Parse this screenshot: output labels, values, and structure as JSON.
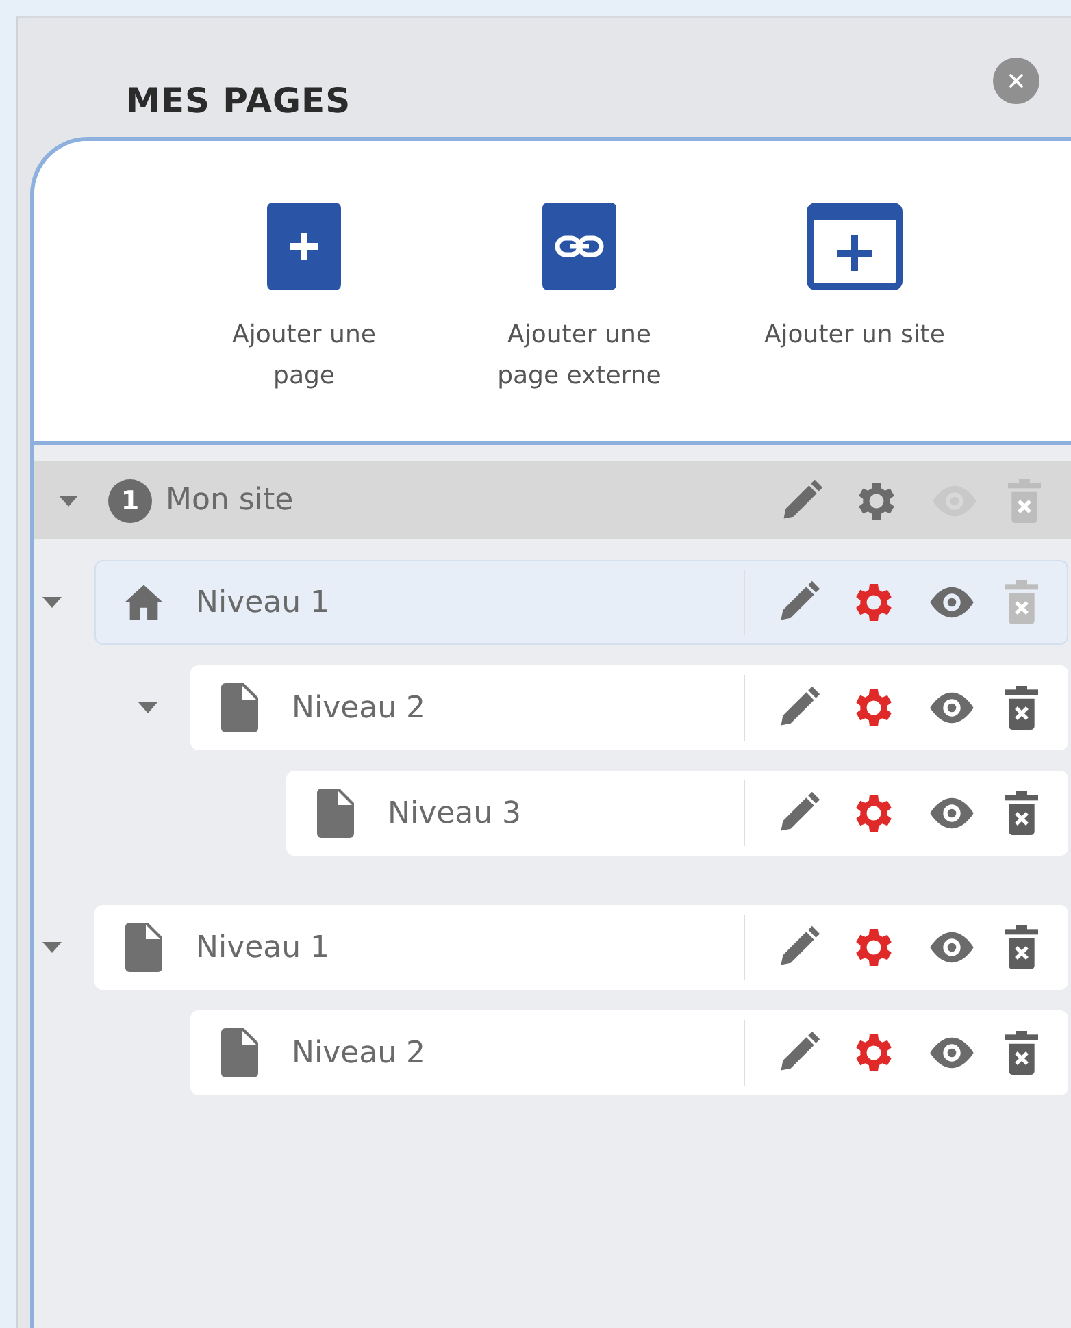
{
  "panel": {
    "title": "MES PAGES"
  },
  "actions": [
    {
      "kind": "plus",
      "label": "Ajouter une page"
    },
    {
      "kind": "link",
      "label": "Ajouter une page externe"
    },
    {
      "kind": "site",
      "label": "Ajouter un site"
    }
  ],
  "tree": {
    "site": {
      "number": "1",
      "label": "Mon site",
      "expanded": true,
      "preview_disabled": true,
      "delete_disabled": true
    },
    "items": [
      {
        "kind": "home",
        "label": "Niveau 1",
        "expanded": true,
        "selected": true,
        "delete_disabled": true,
        "children": [
          {
            "kind": "page",
            "label": "Niveau 2",
            "expanded": true,
            "selected": false,
            "delete_disabled": false,
            "children": [
              {
                "kind": "page",
                "label": "Niveau 3",
                "selected": false,
                "delete_disabled": false
              }
            ]
          }
        ]
      },
      {
        "kind": "page",
        "label": "Niveau 1",
        "expanded": true,
        "selected": false,
        "delete_disabled": false,
        "children": [
          {
            "kind": "page",
            "label": "Niveau 2",
            "selected": false,
            "delete_disabled": false
          }
        ]
      }
    ]
  }
}
